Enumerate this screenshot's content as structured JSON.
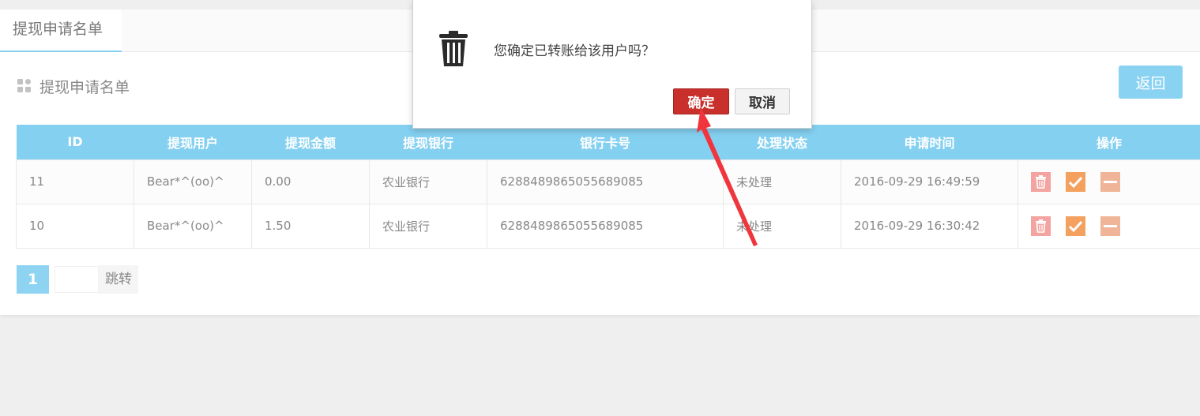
{
  "tab": {
    "label": "提现申请名单"
  },
  "section": {
    "title": "提现申请名单",
    "icon": "grid-icon"
  },
  "back_button": {
    "label": "返回"
  },
  "table": {
    "headers": [
      "ID",
      "提现用户",
      "提现金额",
      "提现银行",
      "银行卡号",
      "处理状态",
      "申请时间",
      "操作"
    ],
    "rows": [
      {
        "id": "11",
        "user": "Bear*^(oo)^",
        "amount": "0.00",
        "bank": "农业银行",
        "card": "6288489865055689085",
        "status": "未处理",
        "time": "2016-09-29 16:49:59"
      },
      {
        "id": "10",
        "user": "Bear*^(oo)^",
        "amount": "1.50",
        "bank": "农业银行",
        "card": "6288489865055689085",
        "status": "未处理",
        "time": "2016-09-29 16:30:42"
      }
    ],
    "action_icons": [
      "trash-icon",
      "check-icon",
      "minus-icon"
    ]
  },
  "pager": {
    "current": "1",
    "jump_label": "跳转",
    "jump_value": ""
  },
  "dialog": {
    "message": "您确定已转账给该用户吗？",
    "confirm_label": "确定",
    "cancel_label": "取消",
    "icon": "trash-icon"
  },
  "colors": {
    "accent": "#84d0f0",
    "confirm": "#c9302c",
    "delete_icon_bg": "#f3a3a0",
    "check_icon_bg": "#f4a15f",
    "minus_icon_bg": "#f0b598",
    "annotation_arrow": "#f0353d"
  }
}
